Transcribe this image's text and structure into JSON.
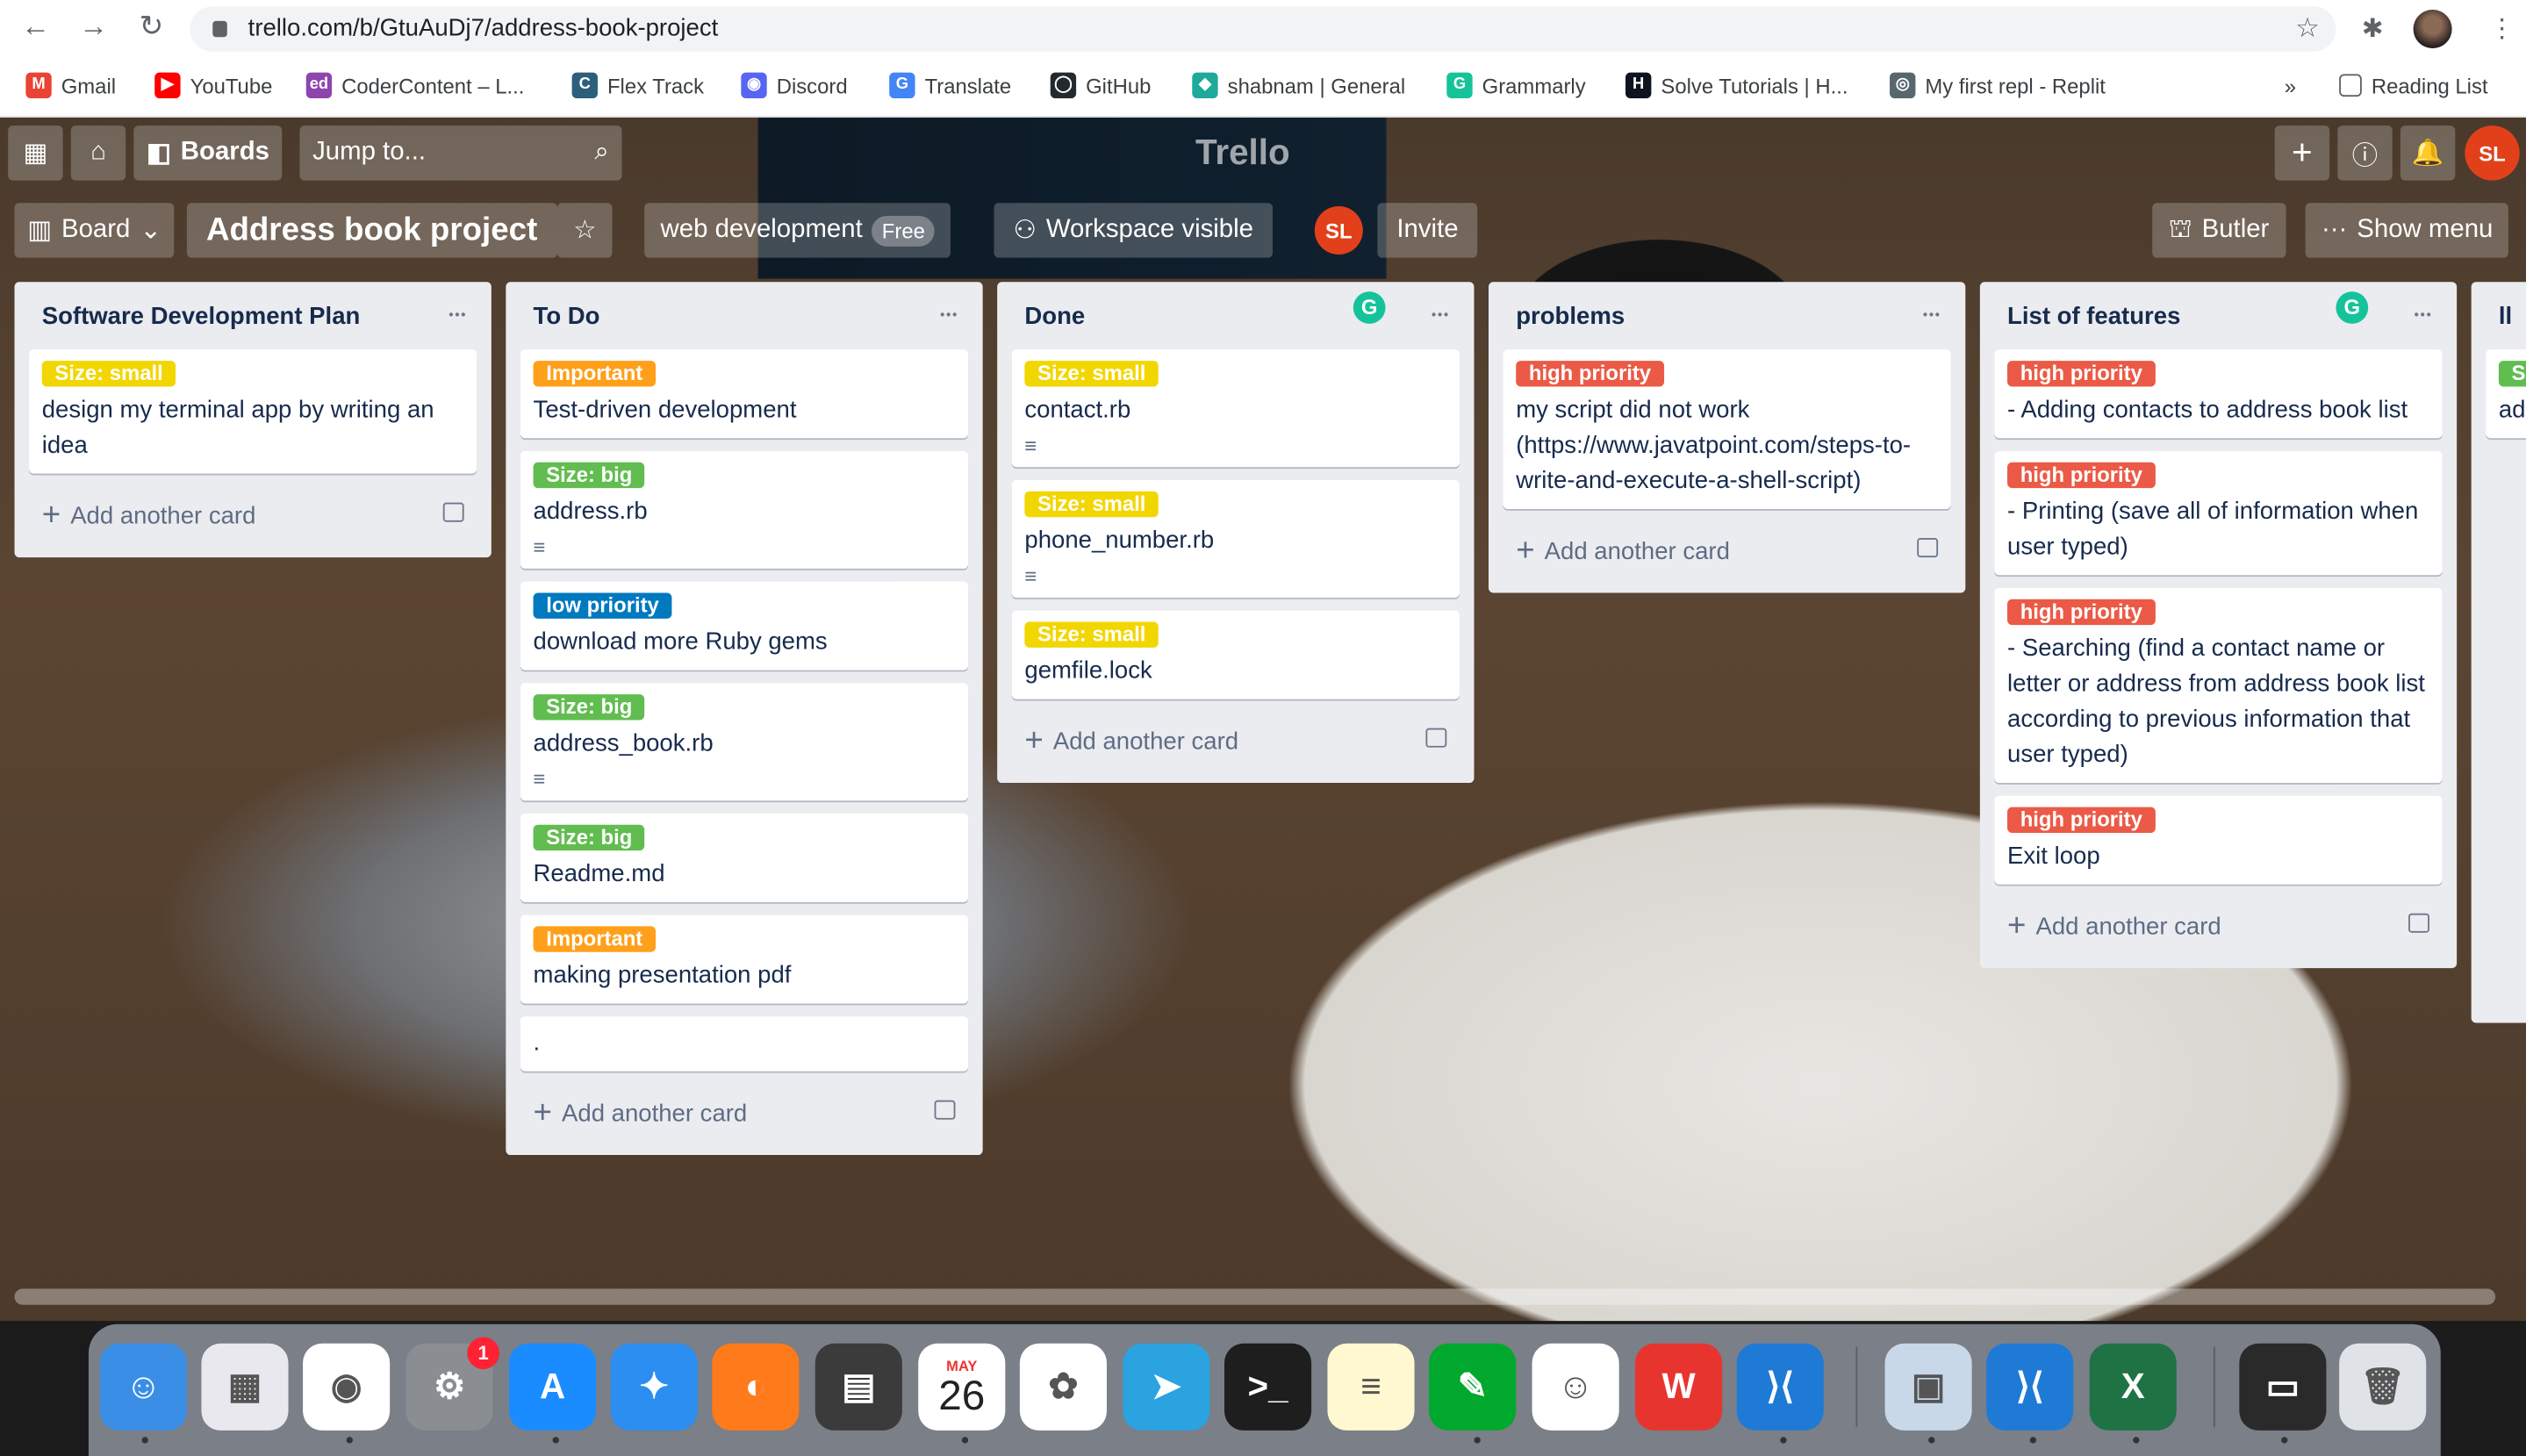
{
  "browser": {
    "url": "trello.com/b/GtuAuDj7/address-book-project",
    "bookmarks": [
      {
        "label": "Gmail",
        "icon": "gmail-icon",
        "color": "#ea4335",
        "glyph": "M"
      },
      {
        "label": "YouTube",
        "icon": "youtube-icon",
        "color": "#ff0000",
        "glyph": "▶"
      },
      {
        "label": "CoderContent – L...",
        "icon": "codercontent-icon",
        "color": "#8e44ad",
        "glyph": "ed"
      },
      {
        "label": "Flex Track",
        "icon": "flextrack-icon",
        "color": "#2c5f7c",
        "glyph": "C"
      },
      {
        "label": "Discord",
        "icon": "discord-icon",
        "color": "#5865f2",
        "glyph": "◉"
      },
      {
        "label": "Translate",
        "icon": "translate-icon",
        "color": "#4285f4",
        "glyph": "G"
      },
      {
        "label": "GitHub",
        "icon": "github-icon",
        "color": "#24292e",
        "glyph": "◯"
      },
      {
        "label": "shabnam | General",
        "icon": "diamond-icon",
        "color": "#1fa99a",
        "glyph": "◆"
      },
      {
        "label": "Grammarly",
        "icon": "grammarly-icon",
        "color": "#15c39a",
        "glyph": "G"
      },
      {
        "label": "Solve Tutorials | H...",
        "icon": "hackerrank-icon",
        "color": "#0e141e",
        "glyph": "H"
      },
      {
        "label": "My first repl - Replit",
        "icon": "replit-icon",
        "color": "#56676e",
        "glyph": "◎"
      }
    ],
    "more": "»",
    "reading_list": "Reading List"
  },
  "header": {
    "boards": "Boards",
    "jump_placeholder": "Jump to...",
    "logo": "Trello",
    "avatar": "SL"
  },
  "board": {
    "view": "Board",
    "title": "Address book project",
    "workspace": "web development",
    "plan": "Free",
    "visibility": "Workspace visible",
    "member": "SL",
    "invite": "Invite",
    "butler": "Butler",
    "menu": "Show menu"
  },
  "label_colors": {
    "yellow": "#f2d600",
    "green": "#61bd4f",
    "blue": "#0079bf",
    "orange": "#ff9f1a",
    "red": "#eb5a46"
  },
  "add_card": "Add another card",
  "lists": [
    {
      "title": "Software Development Plan",
      "cards": [
        {
          "label": "Size: small",
          "color": "yellow",
          "text": "design my terminal app by writing an idea"
        }
      ]
    },
    {
      "title": "To Do",
      "cards": [
        {
          "label": "Important",
          "color": "orange",
          "text": "Test-driven development"
        },
        {
          "label": "Size: big",
          "color": "green",
          "text": "address.rb",
          "desc": true
        },
        {
          "label": "low priority",
          "color": "blue",
          "text": "download more Ruby gems"
        },
        {
          "label": "Size: big",
          "color": "green",
          "text": "address_book.rb",
          "desc": true
        },
        {
          "label": "Size: big",
          "color": "green",
          "text": "Readme.md"
        },
        {
          "label": "Important",
          "color": "orange",
          "text": "making presentation pdf"
        },
        {
          "text": "."
        }
      ]
    },
    {
      "title": "Done",
      "grammarly": true,
      "cards": [
        {
          "label": "Size: small",
          "color": "yellow",
          "text": "contact.rb",
          "desc": true
        },
        {
          "label": "Size: small",
          "color": "yellow",
          "text": "phone_number.rb",
          "desc": true
        },
        {
          "label": "Size: small",
          "color": "yellow",
          "text": "gemfile.lock"
        }
      ]
    },
    {
      "title": "problems",
      "cards": [
        {
          "label": "high priority",
          "color": "red",
          "text": "my script did not work (https://www.javatpoint.com/steps-to-write-and-execute-a-shell-script)"
        }
      ]
    },
    {
      "title": "List of features",
      "grammarly": true,
      "cards": [
        {
          "label": "high priority",
          "color": "red",
          "text": "- Adding contacts to address book list"
        },
        {
          "label": "high priority",
          "color": "red",
          "text": "- Printing (save all of information when user typed)"
        },
        {
          "label": "high priority",
          "color": "red",
          "text": "- Searching (find a contact name or letter or address from address book list according to previous information that user typed)"
        },
        {
          "label": "high priority",
          "color": "red",
          "text": "Exit loop"
        }
      ]
    },
    {
      "title": "ll",
      "partial": true,
      "cards": [
        {
          "label": "S",
          "color": "green",
          "text": "ad"
        }
      ]
    }
  ],
  "dock": {
    "calendar_month": "MAY",
    "calendar_day": "26",
    "badge": "1",
    "apps": [
      {
        "name": "finder",
        "color": "#3a8ee6",
        "glyph": "☺"
      },
      {
        "name": "launchpad",
        "color": "#e8e8ee",
        "glyph": "▦"
      },
      {
        "name": "chrome",
        "color": "#ffffff",
        "glyph": "◉"
      },
      {
        "name": "system-preferences",
        "color": "#8a8d92",
        "glyph": "⚙"
      },
      {
        "name": "app-store",
        "color": "#1a8cff",
        "glyph": "A"
      },
      {
        "name": "safari",
        "color": "#2b8ef0",
        "glyph": "✦"
      },
      {
        "name": "firefox",
        "color": "#ff7a1a",
        "glyph": "◐"
      },
      {
        "name": "calculator",
        "color": "#3b3b3b",
        "glyph": "▤"
      },
      {
        "name": "calendar",
        "color": "#ffffff",
        "glyph": ""
      },
      {
        "name": "photos",
        "color": "#ffffff",
        "glyph": "✿"
      },
      {
        "name": "telegram",
        "color": "#2aa3e0",
        "glyph": "➤"
      },
      {
        "name": "terminal",
        "color": "#1e1e1e",
        "glyph": ">_"
      },
      {
        "name": "notes",
        "color": "#fff8d0",
        "glyph": "≡"
      },
      {
        "name": "evernote",
        "color": "#00a82d",
        "glyph": "✎"
      },
      {
        "name": "smiley",
        "color": "#ffffff",
        "glyph": "☺"
      },
      {
        "name": "wps-office",
        "color": "#e8342f",
        "glyph": "W"
      },
      {
        "name": "vscode",
        "color": "#1f7ad6",
        "glyph": "⟩⟨"
      },
      {
        "name": "preview",
        "color": "#c8d8e8",
        "glyph": "▣"
      },
      {
        "name": "vscode-2",
        "color": "#1f7ad6",
        "glyph": "⟩⟨"
      },
      {
        "name": "excel",
        "color": "#1f7244",
        "glyph": "X"
      },
      {
        "name": "terminal-window",
        "color": "#2a2a2a",
        "glyph": "▭"
      },
      {
        "name": "trash",
        "color": "#dfe3e8",
        "glyph": "🗑"
      }
    ]
  }
}
